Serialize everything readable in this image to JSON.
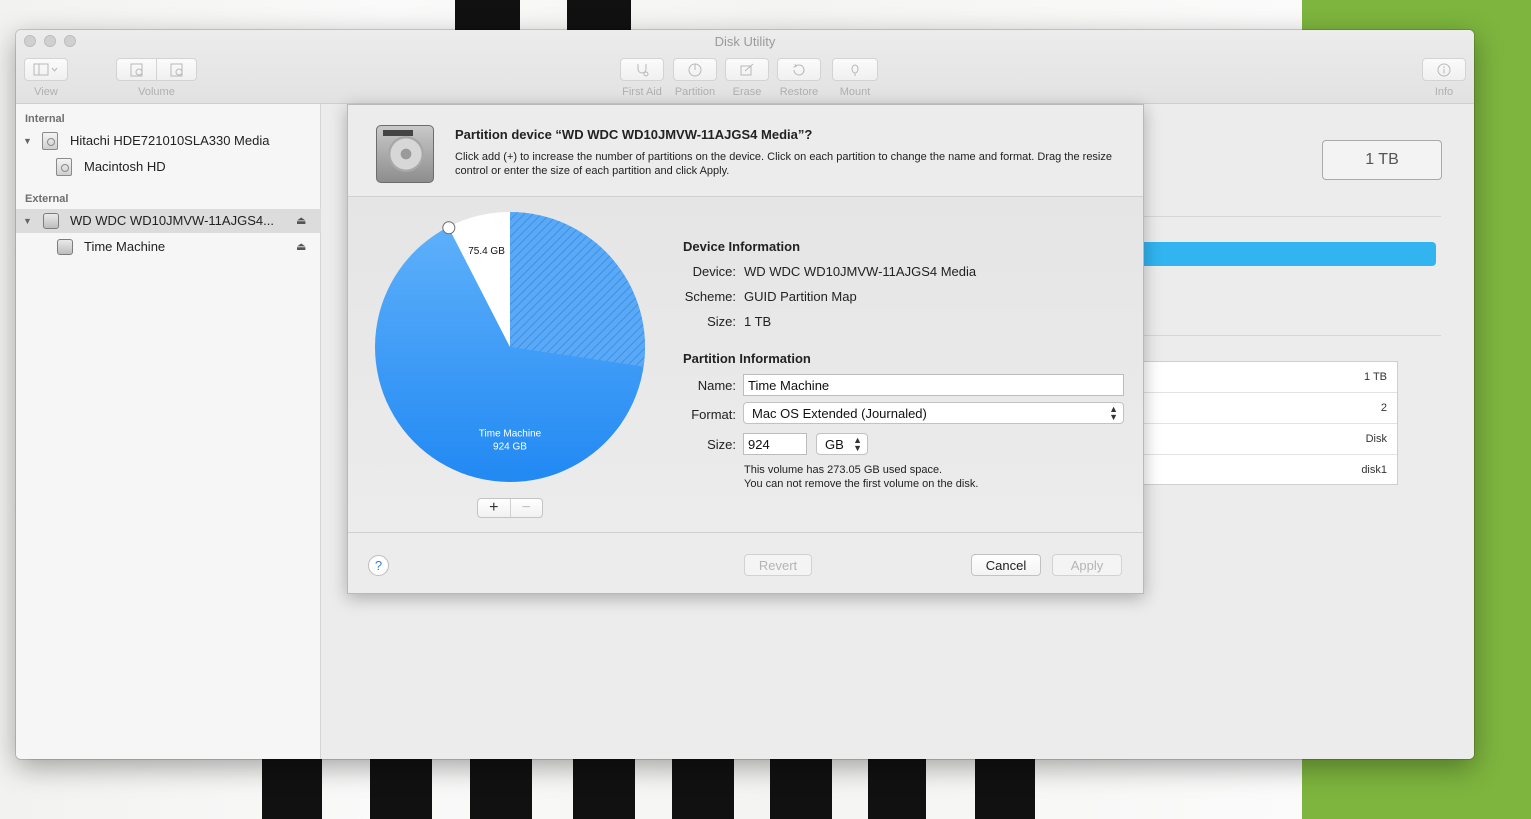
{
  "window": {
    "title": "Disk Utility"
  },
  "toolbar": {
    "view_label": "View",
    "volume_label": "Volume",
    "first_aid_label": "First Aid",
    "partition_label": "Partition",
    "erase_label": "Erase",
    "restore_label": "Restore",
    "mount_label": "Mount",
    "info_label": "Info"
  },
  "sidebar": {
    "internal_header": "Internal",
    "external_header": "External",
    "items": [
      {
        "label": "Hitachi HDE721010SLA330 Media"
      },
      {
        "label": "Macintosh HD"
      },
      {
        "label": "WD WDC WD10JMVW-11AJGS4..."
      },
      {
        "label": "Time Machine"
      }
    ]
  },
  "main": {
    "capacity": "1 TB",
    "info_values": [
      "1 TB",
      "2",
      "Disk",
      "disk1"
    ],
    "usage_color": "#31b4ef"
  },
  "sheet": {
    "title": "Partition device “WD WDC WD10JMVW-11AJGS4 Media”?",
    "description": "Click add (+) to increase the number of partitions on the device. Click on each partition to change the name and format. Drag the resize control or enter the size of each partition and click Apply.",
    "pie": {
      "slices": [
        {
          "label": "Time Machine",
          "size_label": "924 GB",
          "value": 924,
          "color": "#2d93f5"
        },
        {
          "label": "",
          "size_label": "75.4 GB",
          "value": 75.4,
          "color": "#ffffff"
        }
      ],
      "used_fraction_of_selected": 0.2955
    },
    "device_info": {
      "heading": "Device Information",
      "device_label": "Device:",
      "device_value": "WD WDC WD10JMVW-11AJGS4 Media",
      "scheme_label": "Scheme:",
      "scheme_value": "GUID Partition Map",
      "size_label": "Size:",
      "size_value": "1 TB"
    },
    "partition_info": {
      "heading": "Partition Information",
      "name_label": "Name:",
      "name_value": "Time Machine",
      "format_label": "Format:",
      "format_value": "Mac OS Extended (Journaled)",
      "size_label": "Size:",
      "size_value": "924",
      "unit_value": "GB",
      "note_line1": "This volume has 273.05 GB used space.",
      "note_line2": "You can not remove the first volume on the disk."
    },
    "buttons": {
      "help": "?",
      "revert": "Revert",
      "cancel": "Cancel",
      "apply": "Apply",
      "add": "+",
      "remove": "−"
    }
  }
}
